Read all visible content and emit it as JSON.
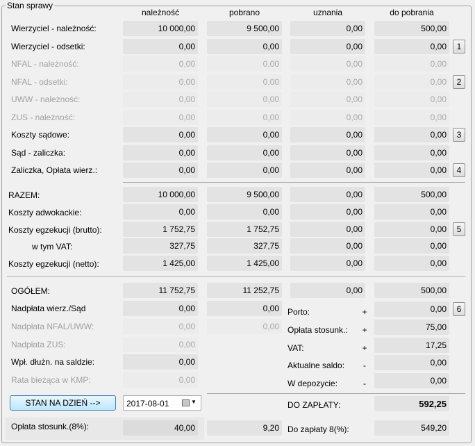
{
  "group_title": "Stan sprawy",
  "columns": [
    "należność",
    "pobrano",
    "uznania",
    "do pobrania"
  ],
  "section1": [
    {
      "label": "Wierzyciel - należność:",
      "values": [
        "10 000,00",
        "9 500,00",
        "0,00",
        "500,00"
      ],
      "disabled": false,
      "button": ""
    },
    {
      "label": "Wierzyciel - odsetki:",
      "values": [
        "0,00",
        "0,00",
        "0,00",
        "0,00"
      ],
      "disabled": false,
      "button": "1"
    },
    {
      "label": "NFAL - należność:",
      "values": [
        "0,00",
        "0,00",
        "0,00",
        "0,00"
      ],
      "disabled": true,
      "button": ""
    },
    {
      "label": "NFAL - odsetki:",
      "values": [
        "0,00",
        "0,00",
        "0,00",
        "0,00"
      ],
      "disabled": true,
      "button": "2"
    },
    {
      "label": "UWW - należność:",
      "values": [
        "0,00",
        "0,00",
        "0,00",
        "0,00"
      ],
      "disabled": true,
      "button": ""
    },
    {
      "label": "ZUS - należność:",
      "values": [
        "0,00",
        "0,00",
        "0,00",
        "0,00"
      ],
      "disabled": true,
      "button": ""
    },
    {
      "label": "Koszty sądowe:",
      "values": [
        "0,00",
        "0,00",
        "0,00",
        "0,00"
      ],
      "disabled": false,
      "button": "3"
    },
    {
      "label": "Sąd - zaliczka:",
      "values": [
        "0,00",
        "0,00",
        "0,00",
        "0,00"
      ],
      "disabled": false,
      "button": ""
    },
    {
      "label": "Zaliczka, Opłata wierz.:",
      "values": [
        "0,00",
        "0,00",
        "0,00",
        "0,00"
      ],
      "disabled": false,
      "button": "4"
    }
  ],
  "section2": [
    {
      "label": "RAZEM:",
      "values": [
        "10 000,00",
        "9 500,00",
        "0,00",
        "500,00"
      ],
      "button": ""
    },
    {
      "label": "Koszty adwokackie:",
      "values": [
        "0,00",
        "0,00",
        "0,00",
        "0,00"
      ],
      "button": ""
    },
    {
      "label": "Koszty egzekucji (brutto):",
      "values": [
        "1 752,75",
        "1 752,75",
        "0,00",
        "0,00"
      ],
      "button": "5"
    },
    {
      "label": "w tym VAT:",
      "values": [
        "327,75",
        "327,75",
        "0,00",
        "0,00"
      ],
      "button": ""
    },
    {
      "label": "Koszty egzekucji (netto):",
      "values": [
        "1 425,00",
        "1 425,00",
        "0,00",
        "0,00"
      ],
      "button": ""
    }
  ],
  "section3": {
    "total": {
      "label": "OGÓŁEM:",
      "values": [
        "11 752,75",
        "11 252,75",
        "0,00",
        "500,00"
      ]
    },
    "left_rows": [
      {
        "label": "Nadpłata wierz./Sąd",
        "value": "0,00",
        "value2": "0,00",
        "disabled": false
      },
      {
        "label": "Nadpłata NFAL/UWW:",
        "value": "0,00",
        "value2": "0,00",
        "disabled": true
      },
      {
        "label": "Nadpłata ZUS:",
        "value": "0,00",
        "disabled": true
      },
      {
        "label": "Wpł. dłużn. na saldzie:",
        "value": "0,00",
        "disabled": false
      },
      {
        "label": "Rata bieżąca w KMP:",
        "value": "0,00",
        "disabled": true
      }
    ],
    "right_rows": [
      {
        "label": "Porto:",
        "sign": "+",
        "value": "0,00"
      },
      {
        "label": "Opłata stosunk.:",
        "sign": "+",
        "value": "75,00"
      },
      {
        "label": "VAT:",
        "sign": "+",
        "value": "17,25"
      },
      {
        "label": "Aktualne saldo:",
        "sign": "-",
        "value": "0,00"
      },
      {
        "label": "W depozycie:",
        "sign": "-",
        "value": "0,00"
      }
    ],
    "button6": "6",
    "stan_button": "STAN NA DZIEŃ -->",
    "date": "2017-08-01",
    "do_zaplaty_label": "DO ZAPŁATY:",
    "do_zaplaty_value": "592,25",
    "oplata_label": "Opłata stosunk.(8%):",
    "oplata_value": "40,00",
    "oplata_value2": "9,20",
    "do_zaplaty8_label": "Do zapłaty 8(%):",
    "do_zaplaty8_value": "549,20"
  }
}
